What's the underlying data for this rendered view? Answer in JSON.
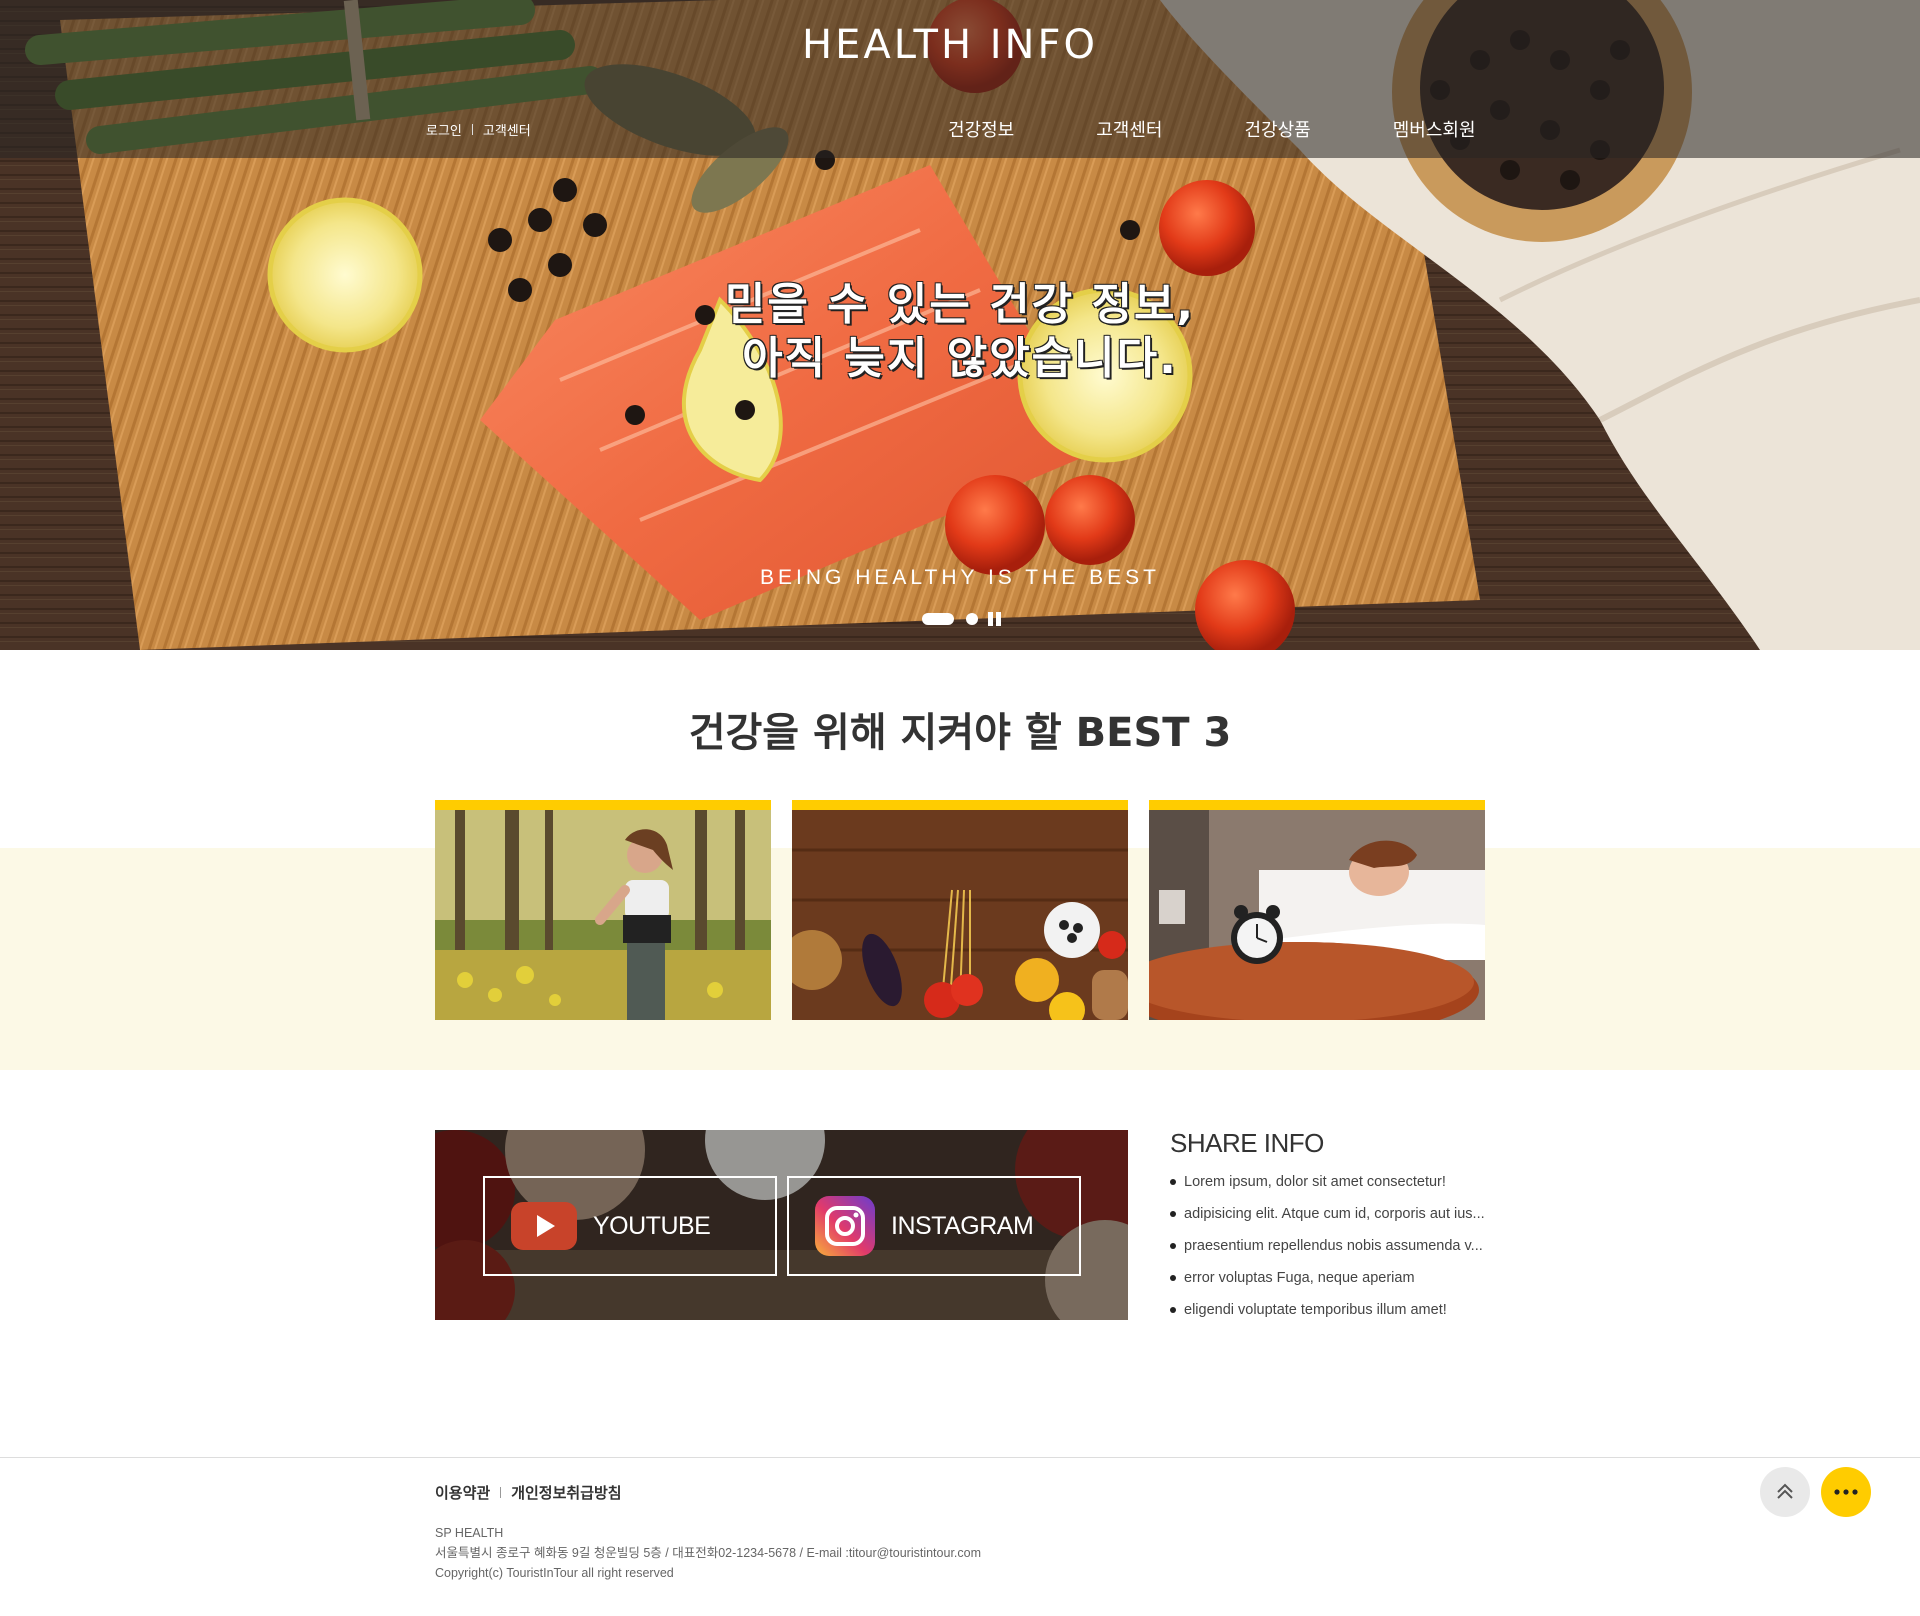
{
  "header": {
    "logo": "HEALTH INFO",
    "util_nav": {
      "login": "로그인",
      "support": "고객센터"
    },
    "gnb": [
      "건강정보",
      "고객센터",
      "건강상품",
      "멤버스회원"
    ]
  },
  "hero": {
    "title_line1": "믿을 수 있는 건강 정보,",
    "title_line2": "아직 늦지 않았습니다.",
    "subtitle": "BEING HEALTHY IS THE BEST",
    "slide_count": 2,
    "active_slide": 1
  },
  "best": {
    "title_prefix": "건강을 위해 지켜야 할",
    "title_strong": "BEST 3",
    "cards": [
      {
        "icon": "running-woman-image"
      },
      {
        "icon": "healthy-food-image"
      },
      {
        "icon": "sleeping-woman-image"
      }
    ]
  },
  "sns": {
    "youtube_label": "YOUTUBE",
    "instagram_label": "INSTAGRAM"
  },
  "share_info": {
    "title": "SHARE INFO",
    "items": [
      "Lorem ipsum, dolor sit amet consectetur!",
      "adipisicing elit. Atque cum id, corporis aut ius...",
      "praesentium repellendus nobis assumenda v...",
      "error voluptas Fuga, neque aperiam",
      "eligendi voluptate temporibus illum amet!"
    ]
  },
  "footer": {
    "terms": "이용약관",
    "privacy": "개인정보취급방침",
    "company": "SP HEALTH",
    "address": "서울특별시 종로구 혜화동 9길 청운빌딩 5층 / 대표전화02-1234-5678 / E-mail :titour@touristintour.com",
    "copyright": "Copyright(c) TouristInTour all right reserved"
  },
  "colors": {
    "accent": "#ffcc00",
    "band": "#fcf9e6",
    "header_overlay": "rgba(40,36,34,0.55)"
  },
  "icons": {
    "top_button": "chevron-up-icon",
    "more_button": "more-dots-icon"
  }
}
